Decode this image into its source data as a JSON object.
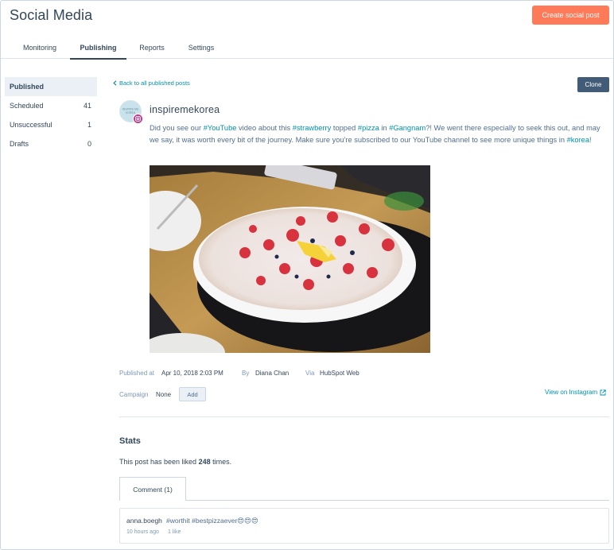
{
  "app": {
    "title": "Social Media",
    "create_button": "Create social post"
  },
  "tabs": [
    {
      "label": "Monitoring"
    },
    {
      "label": "Publishing"
    },
    {
      "label": "Reports"
    },
    {
      "label": "Settings"
    }
  ],
  "sidebar": {
    "items": [
      {
        "label": "Published",
        "count": ""
      },
      {
        "label": "Scheduled",
        "count": "41"
      },
      {
        "label": "Unsuccessful",
        "count": "1"
      },
      {
        "label": "Drafts",
        "count": "0"
      }
    ]
  },
  "post": {
    "back_link": "Back to all published posts",
    "clone_button": "Clone",
    "account": "inspiremekorea",
    "avatar_text": "INSPIRE ME KOREA",
    "text_parts": {
      "t1": "Did you see our ",
      "h1": "#YouTube",
      "t2": " video about this ",
      "h2": "#strawberry",
      "t3": " topped ",
      "h3": "#pizza",
      "t4": " in ",
      "h4": "#Gangnam",
      "t5": "?! We went there especially to seek this out, and may we say, it was worth every bit of the journey. Make sure you're subscribed to our YouTube channel to see more unique things in ",
      "h5": "#korea",
      "t6": "!"
    },
    "published_label": "Published at",
    "published_value": "Apr 10, 2018 2:03 PM",
    "by_label": "By",
    "by_value": "Diana Chan",
    "via_label": "Via",
    "via_value": "HubSpot Web",
    "campaign_label": "Campaign",
    "campaign_value": "None",
    "add_button": "Add",
    "view_link": "View on Instagram"
  },
  "stats": {
    "title": "Stats",
    "likes_prefix": "This post has been liked ",
    "likes_count": "248",
    "likes_suffix": " times."
  },
  "comments": {
    "tab_label": "Comment (1)",
    "items": [
      {
        "author": "anna.boegh",
        "text": "#worthit #bestpizzaever😍😍😍",
        "time": "10 hours ago",
        "likes": "1 like"
      }
    ]
  },
  "colors": {
    "accent": "#ff7a59",
    "link": "#0091ae",
    "text": "#33475b",
    "clone_button": "#425b76",
    "instagram_badge": "#c13584"
  },
  "icons": {
    "back": "chevron-left-icon",
    "external": "external-link-icon",
    "instagram": "instagram-icon"
  }
}
